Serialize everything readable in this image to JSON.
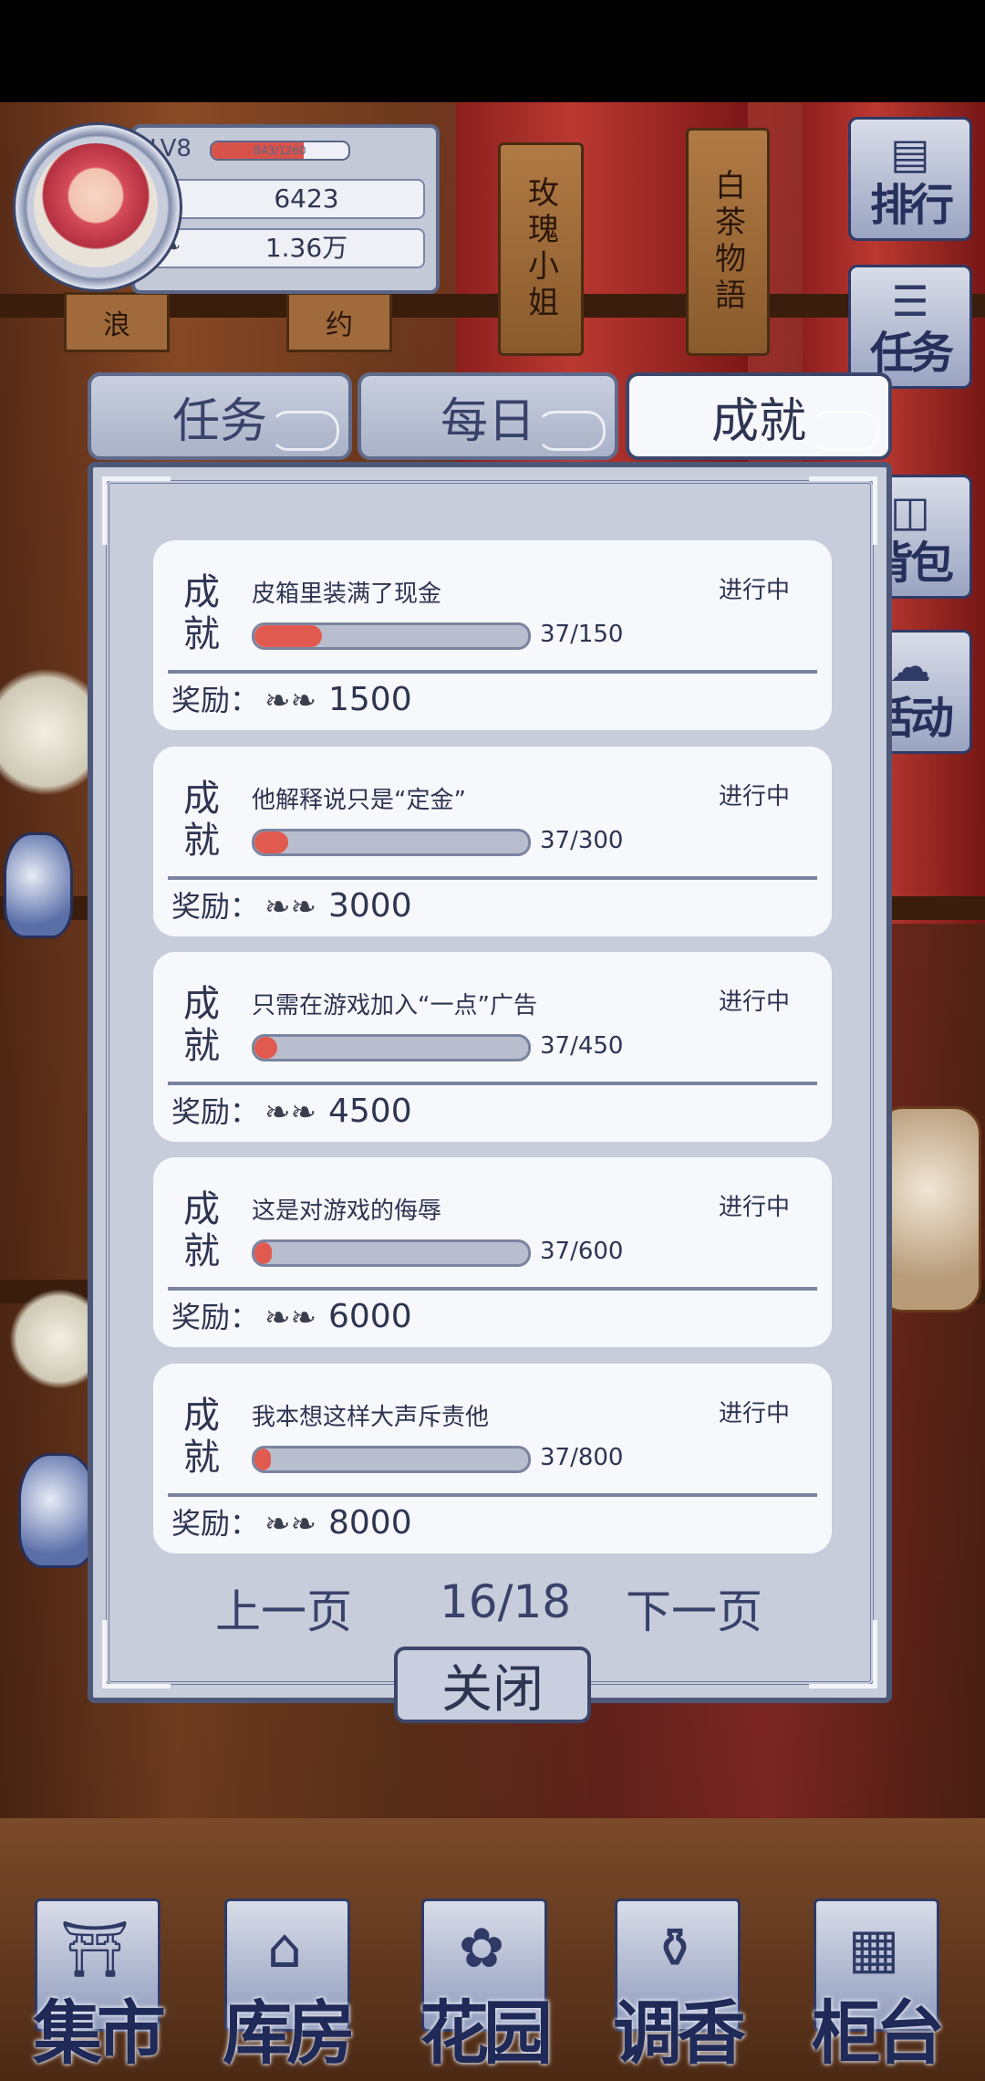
{
  "profile": {
    "level": "LV8",
    "xp_text": "843/1260",
    "xp_fraction": 0.67,
    "petals": "6423",
    "leaves": "1.36万"
  },
  "decor": {
    "tag1": "玫瑰小姐",
    "tag2": "白茶物語",
    "board1": "浪",
    "board2": "约"
  },
  "side_menu": [
    {
      "label": "排行",
      "icon": "ranking-icon"
    },
    {
      "label": "任务",
      "icon": "task-icon"
    },
    {
      "label": "背包",
      "icon": "bag-icon"
    },
    {
      "label": "活动",
      "icon": "event-icon"
    }
  ],
  "tabs": {
    "task": "任务",
    "daily": "每日",
    "achievement": "成就"
  },
  "achievements": [
    {
      "kind": "成就",
      "title": "皮箱里装满了现金",
      "status": "进行中",
      "progress": "37/150",
      "fraction": 0.247,
      "reward_label": "奖励：",
      "reward": "1500"
    },
    {
      "kind": "成就",
      "title": "他解释说只是“定金”",
      "status": "进行中",
      "progress": "37/300",
      "fraction": 0.123,
      "reward_label": "奖励：",
      "reward": "3000"
    },
    {
      "kind": "成就",
      "title": "只需在游戏加入“一点”广告",
      "status": "进行中",
      "progress": "37/450",
      "fraction": 0.082,
      "reward_label": "奖励：",
      "reward": "4500"
    },
    {
      "kind": "成就",
      "title": "这是对游戏的侮辱",
      "status": "进行中",
      "progress": "37/600",
      "fraction": 0.062,
      "reward_label": "奖励：",
      "reward": "6000"
    },
    {
      "kind": "成就",
      "title": "我本想这样大声斥责他",
      "status": "进行中",
      "progress": "37/800",
      "fraction": 0.046,
      "reward_label": "奖励：",
      "reward": "8000"
    }
  ],
  "pager": {
    "prev": "上一页",
    "page": "16/18",
    "next": "下一页"
  },
  "close_label": "关闭",
  "bottom_nav": [
    {
      "label": "集市",
      "icon": "market-icon"
    },
    {
      "label": "库房",
      "icon": "warehouse-icon"
    },
    {
      "label": "花园",
      "icon": "garden-icon"
    },
    {
      "label": "调香",
      "icon": "perfume-icon"
    },
    {
      "label": "柜台",
      "icon": "counter-icon"
    }
  ],
  "colors": {
    "panel": "#c8cddc",
    "card": "#f7f8fb",
    "text": "#2e3552",
    "progress_fill": "#e05a50",
    "frame": "#4d5878"
  }
}
